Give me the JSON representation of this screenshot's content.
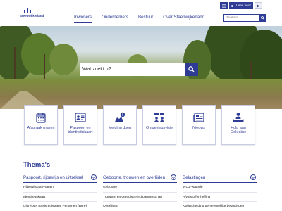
{
  "logo": {
    "text": "Steenwijkerland"
  },
  "nav": [
    "Inwoners",
    "Ondernemers",
    "Bestuur",
    "Over Steenwijkerland"
  ],
  "utility": {
    "menu_icon": "menu-icon",
    "read_label": "Lees voor",
    "play_icon": "play-icon"
  },
  "header_search": {
    "placeholder": "Zoeken"
  },
  "hero": {
    "search_placeholder": "Wat zoekt u?"
  },
  "tiles": [
    {
      "label": "Afspraak maken",
      "icon": "calendar-icon"
    },
    {
      "label": "Paspoort en\nidentiteitskaart",
      "icon": "id-card-icon"
    },
    {
      "label": "Melding doen",
      "icon": "report-icon"
    },
    {
      "label": "Omgevingsvisie",
      "icon": "discussion-icon"
    },
    {
      "label": "Nieuws",
      "icon": "newspaper-icon"
    },
    {
      "label": "Hulp aan\nOekraïne",
      "icon": "help-icon"
    }
  ],
  "themes": {
    "title": "Thema's",
    "columns": [
      {
        "header": "Paspoort, rijbewijs en uittreksel",
        "items": [
          "Rijbewijs aanvragen",
          "Identiteitskaart",
          "Uittreksel Basisregistratie Personen (BRP)"
        ]
      },
      {
        "header": "Geboorte, trouwen en overlijden",
        "items": [
          "Geboorte",
          "Trouwen en geregistreerd partnerschap",
          "Overlijden"
        ]
      },
      {
        "header": "Belastingen",
        "items": [
          "WOZ-waarde",
          "Afvalstoffenheffing",
          "Kwijtschelding gemeentelijke belastingen"
        ]
      }
    ]
  },
  "colors": {
    "brand": "#2e3c95"
  }
}
